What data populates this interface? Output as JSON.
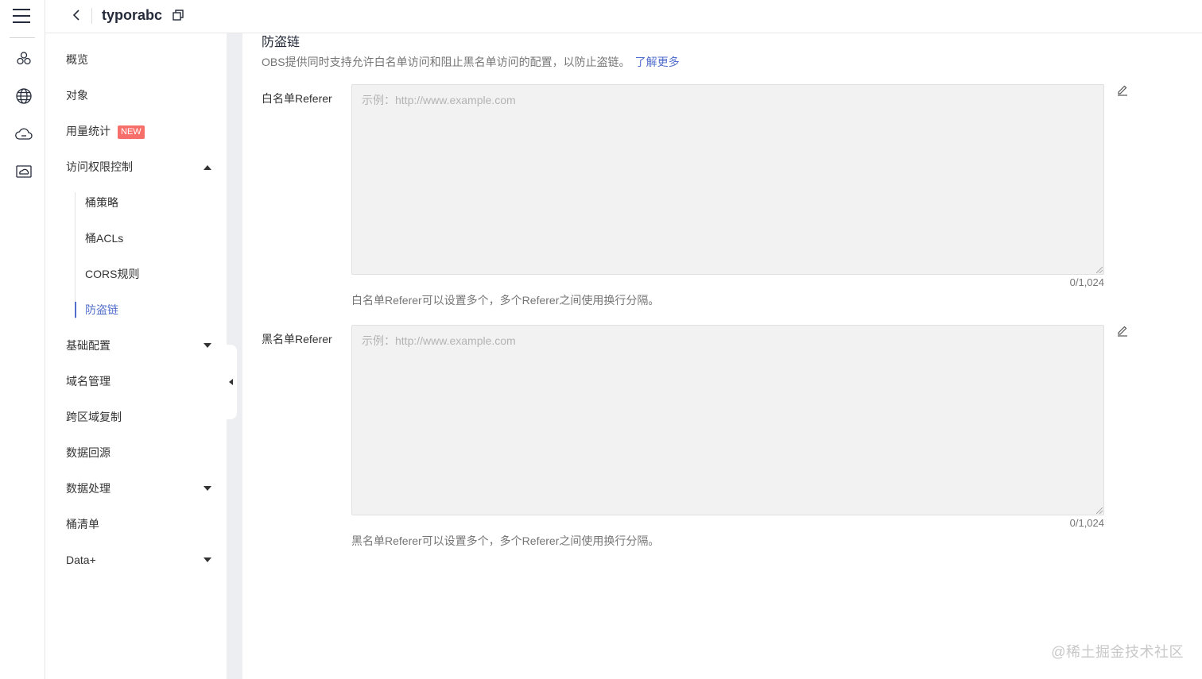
{
  "header": {
    "title": "typorabc"
  },
  "rail": {
    "icons": [
      "menu-icon",
      "cluster-icon",
      "globe-icon",
      "cloud-icon",
      "storage-icon"
    ]
  },
  "nav": {
    "items": [
      {
        "label": "概览"
      },
      {
        "label": "对象"
      },
      {
        "label": "用量统计",
        "badge": "NEW"
      },
      {
        "label": "访问权限控制"
      },
      {
        "label": "基础配置"
      },
      {
        "label": "域名管理"
      },
      {
        "label": "跨区域复制"
      },
      {
        "label": "数据回源"
      },
      {
        "label": "数据处理"
      },
      {
        "label": "桶清单"
      },
      {
        "label": "Data+"
      }
    ],
    "sub_items": [
      {
        "label": "桶策略"
      },
      {
        "label": "桶ACLs"
      },
      {
        "label": "CORS规则"
      },
      {
        "label": "防盗链"
      }
    ],
    "active": "防盗链"
  },
  "section": {
    "title": "防盗链",
    "description": "OBS提供同时支持允许白名单访问和阻止黑名单访问的配置，以防止盗链。",
    "learn_more": "了解更多"
  },
  "whitelist": {
    "label": "白名单Referer",
    "placeholder": "示例：http://www.example.com",
    "value": "",
    "counter": "0/1,024",
    "hint": "白名单Referer可以设置多个，多个Referer之间使用换行分隔。"
  },
  "blacklist": {
    "label": "黑名单Referer",
    "placeholder": "示例：http://www.example.com",
    "value": "",
    "counter": "0/1,024",
    "hint": "黑名单Referer可以设置多个，多个Referer之间使用换行分隔。"
  },
  "watermark": "@稀土掘金技术社区",
  "colors": {
    "accent": "#526ecc",
    "badge": "#f66f6a",
    "separator": "#eceef1",
    "textarea_bg": "#f2f2f2"
  }
}
